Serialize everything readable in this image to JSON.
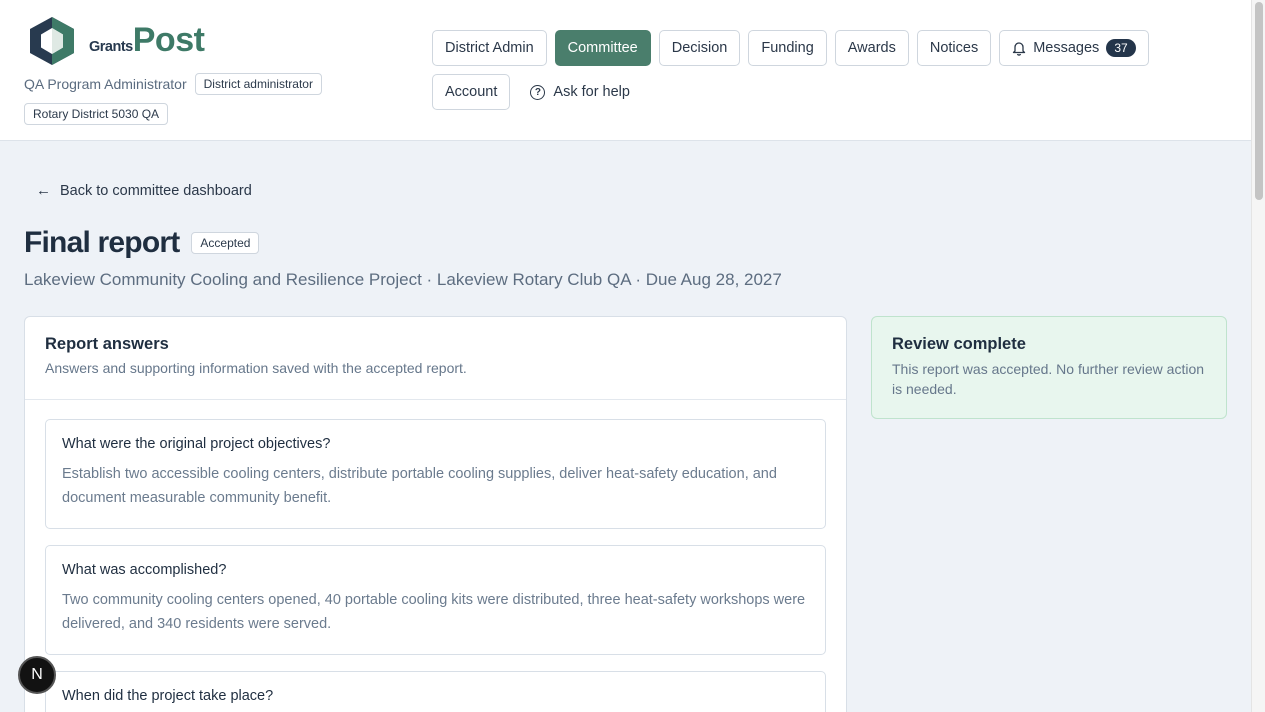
{
  "brand": {
    "name_part1": "Grants",
    "name_part2": "Post",
    "accent": "#3e7a67",
    "dark": "#283a4f"
  },
  "user": {
    "name": "QA Program Administrator",
    "role": "District administrator",
    "district": "Rotary District 5030 QA"
  },
  "nav": {
    "items": [
      {
        "label": "District Admin"
      },
      {
        "label": "Committee",
        "active": true
      },
      {
        "label": "Decision"
      },
      {
        "label": "Funding"
      },
      {
        "label": "Awards"
      },
      {
        "label": "Notices"
      }
    ],
    "messages_label": "Messages",
    "messages_count": "37",
    "account_label": "Account",
    "help_label": "Ask for help"
  },
  "back_link": "Back to committee dashboard",
  "page": {
    "title": "Final report",
    "status": "Accepted",
    "subtitle": "Lakeview Community Cooling and Resilience Project · Lakeview Rotary Club QA · Due Aug 28, 2027"
  },
  "answers_card": {
    "title": "Report answers",
    "description": "Answers and supporting information saved with the accepted report.",
    "items": [
      {
        "question": "What were the original project objectives?",
        "answer": "Establish two accessible cooling centers, distribute portable cooling supplies, deliver heat-safety education, and document measurable community benefit."
      },
      {
        "question": "What was accomplished?",
        "answer": "Two community cooling centers opened, 40 portable cooling kits were distributed, three heat-safety workshops were delivered, and 340 residents were served."
      },
      {
        "question": "When did the project take place?",
        "answer": ""
      }
    ]
  },
  "review": {
    "title": "Review complete",
    "text": "This report was accepted. No further review action is needed."
  },
  "dev_badge": "N"
}
